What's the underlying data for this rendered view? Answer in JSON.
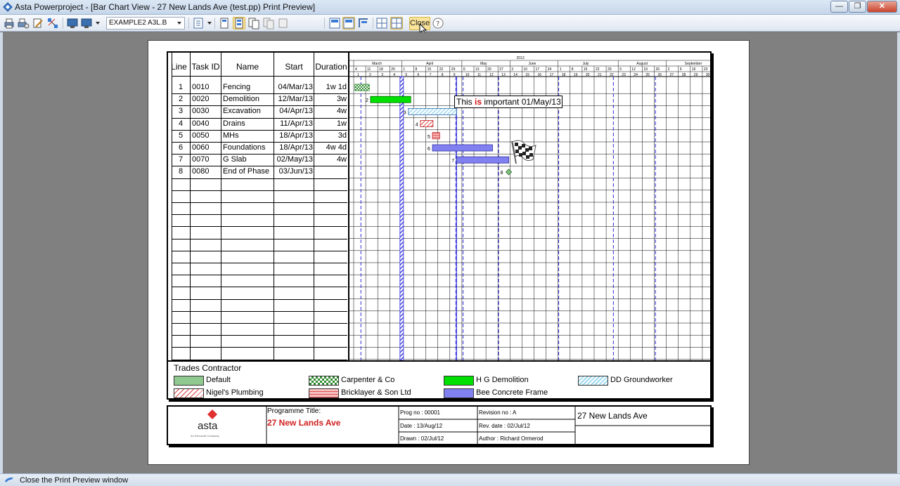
{
  "window": {
    "title": "Asta Powerproject - [Bar Chart View - 27 New Lands Ave (test.pp)  Print Preview]",
    "minimize": "—",
    "restore": "❐",
    "close": "✕"
  },
  "toolbar": {
    "page_setup_value": "EXAMPLE2 A3L.B",
    "close_label": "Close"
  },
  "grid": {
    "headers": {
      "line": "Line",
      "task_id": "Task ID",
      "name": "Name",
      "start": "Start",
      "duration": "Duration"
    },
    "rows": [
      {
        "line": "1",
        "task_id": "0010",
        "name": "Fencing",
        "start": "04/Mar/13",
        "duration": "1w 1d"
      },
      {
        "line": "2",
        "task_id": "0020",
        "name": "Demolition",
        "start": "12/Mar/13",
        "duration": "3w"
      },
      {
        "line": "3",
        "task_id": "0030",
        "name": "Excavation",
        "start": "04/Apr/13",
        "duration": "4w"
      },
      {
        "line": "4",
        "task_id": "0040",
        "name": "Drains",
        "start": "11/Apr/13",
        "duration": "1w"
      },
      {
        "line": "5",
        "task_id": "0050",
        "name": "MHs",
        "start": "18/Apr/13",
        "duration": "3d"
      },
      {
        "line": "6",
        "task_id": "0060",
        "name": "Foundations",
        "start": "18/Apr/13",
        "duration": "4w 4d"
      },
      {
        "line": "7",
        "task_id": "0070",
        "name": "G Slab",
        "start": "02/May/13",
        "duration": "4w"
      },
      {
        "line": "8",
        "task_id": "0080",
        "name": "End of Phase",
        "start": "03/Jun/13",
        "duration": ""
      }
    ]
  },
  "timescale": {
    "year": "2013",
    "months": [
      "March",
      "April",
      "May",
      "June",
      "July",
      "August",
      "September"
    ],
    "days": [
      "4",
      "11",
      "18",
      "25",
      "1",
      "8",
      "15",
      "22",
      "29",
      "6",
      "13",
      "20",
      "27",
      "3",
      "10",
      "17",
      "24",
      "1",
      "8",
      "15",
      "22",
      "29",
      "5",
      "12",
      "19",
      "26",
      "2",
      "9",
      "16",
      "23"
    ],
    "weeks": [
      "1",
      "2",
      "3",
      "4",
      "5",
      "6",
      "7",
      "8",
      "9",
      "10",
      "11",
      "12",
      "13",
      "14",
      "15",
      "16",
      "17",
      "18",
      "19",
      "20",
      "21",
      "22",
      "23",
      "24",
      "25",
      "26",
      "27",
      "28",
      "29",
      "30"
    ]
  },
  "bars": [
    {
      "line": "1",
      "label": ""
    },
    {
      "line": "2",
      "label": "2"
    },
    {
      "line": "3",
      "label": "3"
    },
    {
      "line": "4",
      "label": "4"
    },
    {
      "line": "5",
      "label": "5"
    },
    {
      "line": "6",
      "label": "6"
    },
    {
      "line": "7",
      "label": "7"
    },
    {
      "line": "8",
      "label": "8"
    }
  ],
  "callout": {
    "prefix": "This ",
    "highlight": "is",
    "suffix": " important 01/May/13"
  },
  "legend": {
    "title": "Trades Contractor",
    "items": [
      {
        "label": "Default",
        "color": "#8fc98f"
      },
      {
        "label": "Carpenter & Co",
        "color": "#2e8b2e"
      },
      {
        "label": "H G Demolition",
        "color": "#00e000"
      },
      {
        "label": "DD Groundworker",
        "color": "#9fd9ef"
      },
      {
        "label": "Nigel's Plumbing",
        "color": "#e04040"
      },
      {
        "label": "Bricklayer & Son Ltd",
        "color": "#e05050"
      },
      {
        "label": "Bee Concrete Frame",
        "color": "#8080f0"
      }
    ]
  },
  "title_block": {
    "logo_text": "asta",
    "logo_sub": "An Elecosoft Company",
    "programme_label": "Programme Title:",
    "programme_value": "27 New Lands Ave",
    "prog_no": "Prog no : 00001",
    "revision_no": "Revision no : A",
    "date": "Date : 13/Aug/12",
    "rev_date": "Rev. date : 02/Jul/12",
    "drawn": "Drawn : 02/Jul/12",
    "author": "Author : Richard Ormerod",
    "project_name": "27 New Lands Ave"
  },
  "status_bar": {
    "text": "Close the Print Preview window"
  }
}
